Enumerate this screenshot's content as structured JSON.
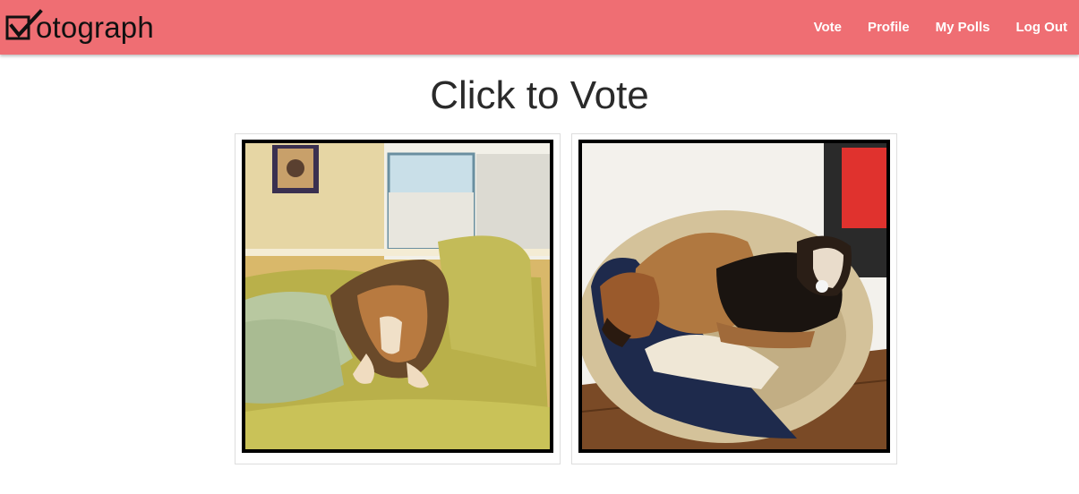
{
  "app": {
    "name": "otograph",
    "logo_icon": "checkbox-check-icon"
  },
  "nav": {
    "items": [
      "Vote",
      "Profile",
      "My Polls",
      "Log Out"
    ]
  },
  "page": {
    "title": "Click to Vote"
  },
  "photos": [
    {
      "subject": "dog sleeping on couch"
    },
    {
      "subject": "two dogs in dog bed"
    }
  ],
  "colors": {
    "navbar": "#ef6e73",
    "nav_text": "#ffffff",
    "title": "#2a2a2a"
  }
}
